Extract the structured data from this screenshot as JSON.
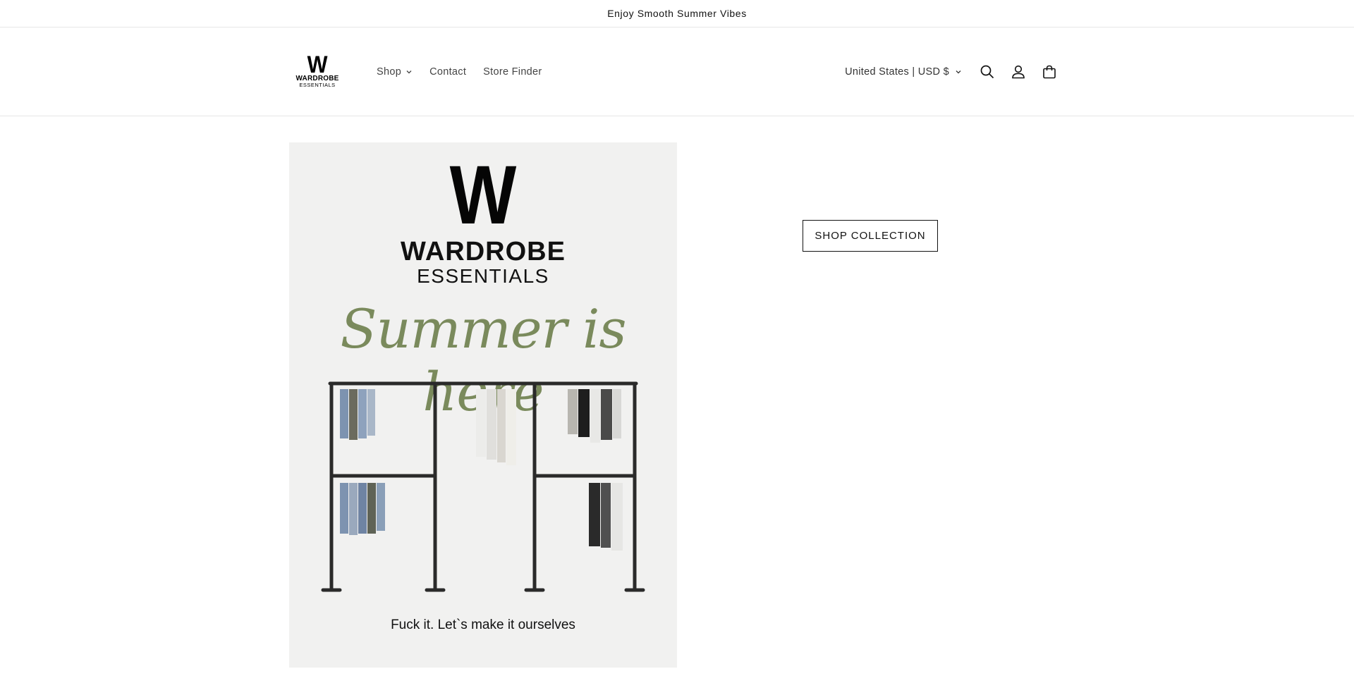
{
  "announcement": {
    "text": "Enjoy Smooth Summer Vibes"
  },
  "header": {
    "logo": {
      "letter": "W",
      "line1": "WARDROBE",
      "line2": "ESSENTIALS"
    },
    "nav": [
      {
        "label": "Shop",
        "has_dropdown": true
      },
      {
        "label": "Contact"
      },
      {
        "label": "Store Finder"
      }
    ],
    "locale": "United States | USD $",
    "icons": [
      "search-icon",
      "account-icon",
      "cart-icon"
    ]
  },
  "hero": {
    "image": {
      "logo_letter": "W",
      "brand_line1": "WARDROBE",
      "brand_line2": "ESSENTIALS",
      "script_text": "Summer is here",
      "tagline": "Fuck it. Let`s make it ourselves"
    },
    "button_label": "SHOP COLLECTION"
  },
  "colors": {
    "script_green": "#7a8a5c",
    "border": "#e6e6e6",
    "text": "#121212"
  }
}
